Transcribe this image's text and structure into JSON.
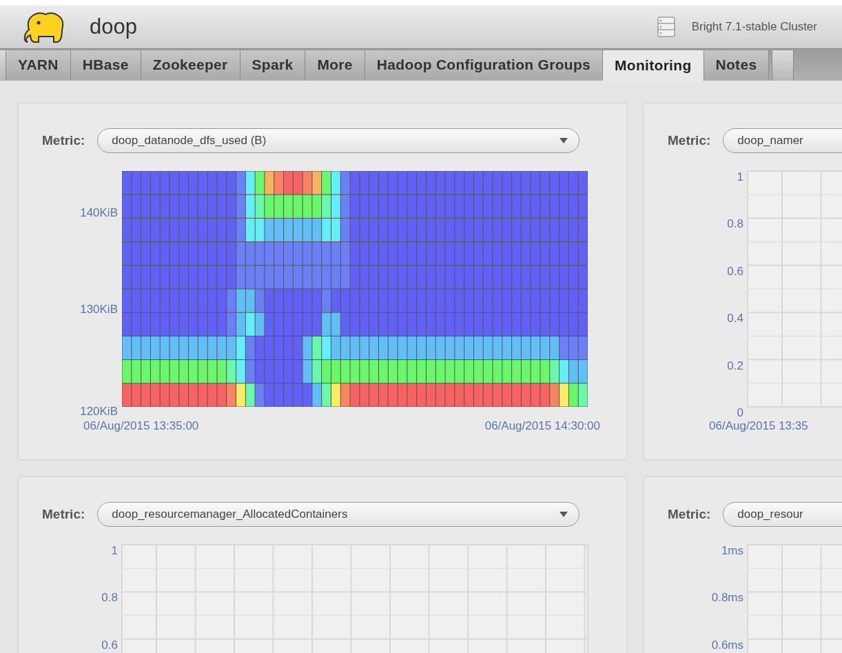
{
  "header": {
    "app_name": "doop",
    "cluster": "Bright 7.1-stable Cluster"
  },
  "tabs": [
    {
      "label": "YARN",
      "selected": false
    },
    {
      "label": "HBase",
      "selected": false
    },
    {
      "label": "Zookeeper",
      "selected": false
    },
    {
      "label": "Spark",
      "selected": false
    },
    {
      "label": "More",
      "selected": false
    },
    {
      "label": "Hadoop Configuration Groups",
      "selected": false
    },
    {
      "label": "Monitoring",
      "selected": true
    },
    {
      "label": "Notes",
      "selected": false
    }
  ],
  "panels": [
    {
      "kind": "heatmap",
      "metric_label": "Metric:",
      "metric": "doop_datanode_dfs_used (B)",
      "y_labels": [
        "140KiB",
        "130KiB",
        "120KiB"
      ],
      "x_labels": [
        "06/Aug/2015 13:35:00",
        "06/Aug/2015 14:30:00"
      ]
    },
    {
      "kind": "empty",
      "metric_label": "Metric:",
      "metric": "doop_namer",
      "y_labels": [
        "1",
        "0.8",
        "0.6",
        "0.4",
        "0.2",
        "0"
      ],
      "x_labels": [
        "06/Aug/2015 13:35"
      ]
    },
    {
      "kind": "empty",
      "metric_label": "Metric:",
      "metric": "doop_resourcemanager_AllocatedContainers",
      "y_labels": [
        "1",
        "0.8",
        "0.6"
      ]
    },
    {
      "kind": "empty",
      "metric_label": "Metric:",
      "metric": "doop_resour",
      "y_labels": [
        "1ms",
        "0.8ms",
        "0.6ms"
      ]
    }
  ]
}
